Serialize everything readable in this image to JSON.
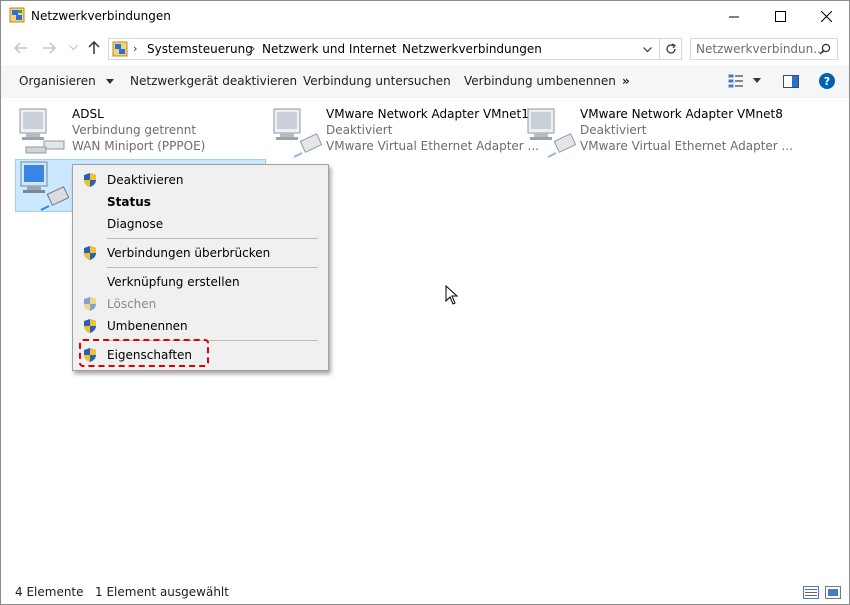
{
  "window": {
    "title": "Netzwerkverbindungen"
  },
  "nav": {
    "breadcrumbs": [
      "Systemsteuerung",
      "Netzwerk und Internet",
      "Netzwerkverbindungen"
    ],
    "search_placeholder": "Netzwerkverbindun..."
  },
  "commands": {
    "organize": "Organisieren",
    "disable": "Netzwerkgerät deaktivieren",
    "diagnose": "Verbindung untersuchen",
    "rename": "Verbindung umbenennen",
    "more": "»"
  },
  "connections": [
    {
      "name": "ADSL",
      "status": "Verbindung getrennt",
      "device": "WAN Miniport (PPPOE)"
    },
    {
      "name": "VMware Network Adapter VMnet1",
      "status": "Deaktiviert",
      "device": "VMware Virtual Ethernet Adapter ..."
    },
    {
      "name": "VMware Network Adapter VMnet8",
      "status": "Deaktiviert",
      "device": "VMware Virtual Ethernet Adapter ..."
    }
  ],
  "context_menu": {
    "items": [
      {
        "label": "Deaktivieren",
        "shield": true,
        "bold": false,
        "disabled": false
      },
      {
        "label": "Status",
        "shield": false,
        "bold": true,
        "disabled": false
      },
      {
        "label": "Diagnose",
        "shield": false,
        "bold": false,
        "disabled": false
      },
      {
        "label": "Verbindungen überbrücken",
        "shield": true,
        "bold": false,
        "disabled": false
      },
      {
        "label": "Verknüpfung erstellen",
        "shield": false,
        "bold": false,
        "disabled": false
      },
      {
        "label": "Löschen",
        "shield": true,
        "bold": false,
        "disabled": true
      },
      {
        "label": "Umbenennen",
        "shield": true,
        "bold": false,
        "disabled": false
      },
      {
        "label": "Eigenschaften",
        "shield": true,
        "bold": false,
        "disabled": false
      }
    ]
  },
  "status_bar": {
    "count": "4 Elemente",
    "selected": "1 Element ausgewählt"
  },
  "colors": {
    "accent": "#0063b1",
    "selection": "#cce8ff",
    "highlight": "#e00000"
  }
}
